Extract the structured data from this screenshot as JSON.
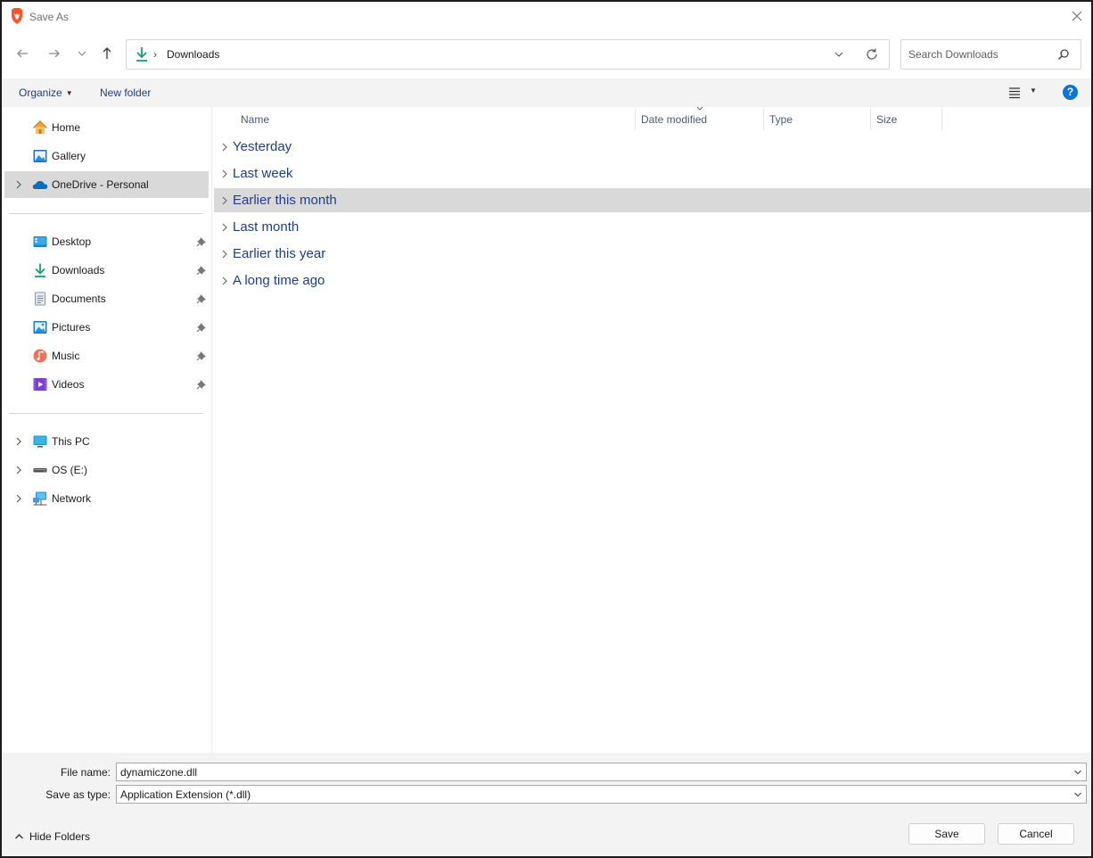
{
  "window": {
    "title": "Save As",
    "app_icon": "brave-lion-icon",
    "close_icon": "close-icon"
  },
  "navigation": {
    "back_icon": "arrow-left-icon",
    "forward_icon": "arrow-right-icon",
    "recent_icon": "chevron-down-icon",
    "up_icon": "arrow-up-icon",
    "address": {
      "icon": "downloads-icon",
      "separator": "›",
      "breadcrumb": "Downloads"
    },
    "search": {
      "placeholder": "Search Downloads",
      "icon": "search-icon"
    }
  },
  "toolbar": {
    "organize_label": "Organize",
    "new_folder_label": "New folder",
    "help_label": "?"
  },
  "sidebar": {
    "quick": [
      {
        "label": "Home",
        "icon": "home-icon"
      },
      {
        "label": "Gallery",
        "icon": "gallery-icon"
      },
      {
        "label": "OneDrive - Personal",
        "icon": "onedrive-cloud-icon",
        "selected": true
      }
    ],
    "pinned": [
      {
        "label": "Desktop",
        "icon": "desktop-icon"
      },
      {
        "label": "Downloads",
        "icon": "downloads-icon"
      },
      {
        "label": "Documents",
        "icon": "documents-icon"
      },
      {
        "label": "Pictures",
        "icon": "pictures-icon"
      },
      {
        "label": "Music",
        "icon": "music-icon"
      },
      {
        "label": "Videos",
        "icon": "videos-icon"
      }
    ],
    "devices": [
      {
        "label": "This PC",
        "icon": "this-pc-icon"
      },
      {
        "label": "OS (E:)",
        "icon": "drive-icon"
      },
      {
        "label": "Network",
        "icon": "network-icon"
      }
    ]
  },
  "content": {
    "columns": [
      "Name",
      "Date modified",
      "Type",
      "Size"
    ],
    "groups": [
      {
        "label": "Yesterday"
      },
      {
        "label": "Last week"
      },
      {
        "label": "Earlier this month",
        "selected": true
      },
      {
        "label": "Last month"
      },
      {
        "label": "Earlier this year"
      },
      {
        "label": "A long time ago"
      }
    ]
  },
  "form": {
    "file_name_label": "File name:",
    "file_name_value": "dynamiczone.dll",
    "save_type_label": "Save as type:",
    "save_type_value": "Application Extension (*.dll)"
  },
  "footer": {
    "hide_folders_label": "Hide Folders",
    "save_label": "Save",
    "cancel_label": "Cancel"
  },
  "colors": {
    "accent": "#0a74da",
    "group_text": "#1f3f8a",
    "selection": "#d9d9d9",
    "panel_bg": "#f3f3f3"
  }
}
